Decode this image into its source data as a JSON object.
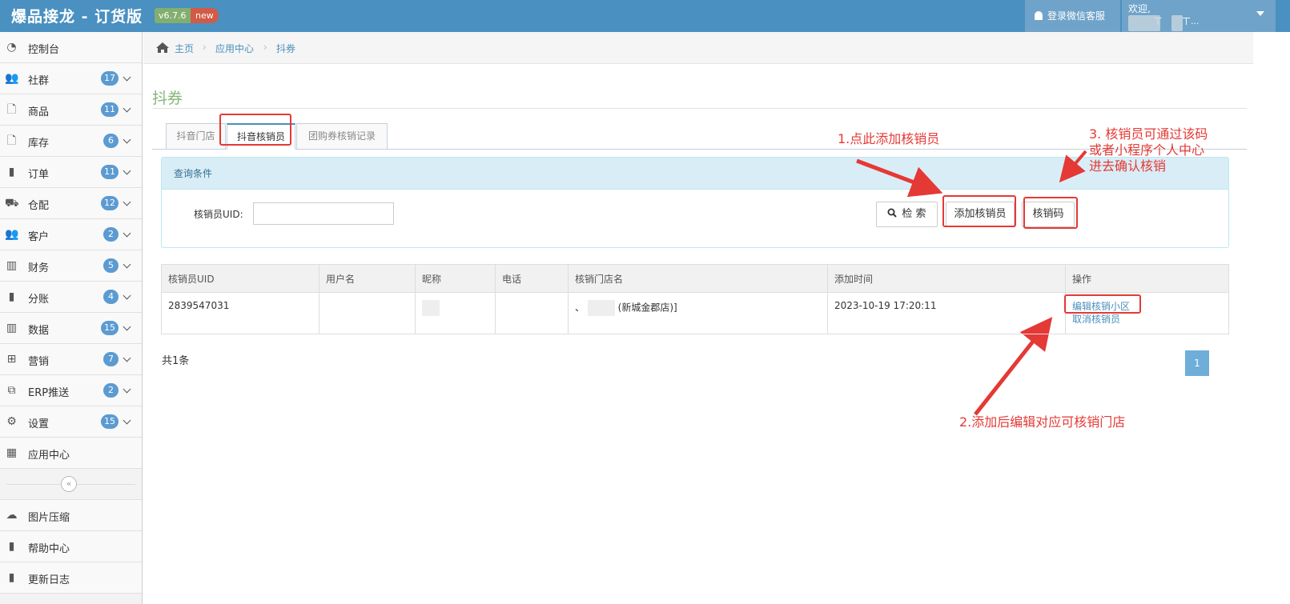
{
  "app": {
    "title": "爆品接龙 - 订货版",
    "version": "v6.7.6",
    "new_badge": "new"
  },
  "topbar": {
    "wechat_service": "登录微信客服",
    "welcome": "欢迎,",
    "user_masked": "         ㄒ       ㄒ..."
  },
  "sidebar": {
    "items": [
      {
        "label": "控制台",
        "icon": "dashboard-icon"
      },
      {
        "label": "社群",
        "count": "17",
        "icon": "users-icon"
      },
      {
        "label": "商品",
        "count": "11",
        "icon": "file-icon"
      },
      {
        "label": "库存",
        "count": "6",
        "icon": "file-icon"
      },
      {
        "label": "订单",
        "count": "11",
        "icon": "book-icon"
      },
      {
        "label": "仓配",
        "count": "12",
        "icon": "truck-icon"
      },
      {
        "label": "客户",
        "count": "2",
        "icon": "users-icon"
      },
      {
        "label": "财务",
        "count": "5",
        "icon": "bar-chart-icon"
      },
      {
        "label": "分账",
        "count": "4",
        "icon": "book-icon"
      },
      {
        "label": "数据",
        "count": "15",
        "icon": "bar-chart-icon"
      },
      {
        "label": "营销",
        "count": "7",
        "icon": "gift-icon"
      },
      {
        "label": "ERP推送",
        "count": "2",
        "icon": "copy-icon"
      },
      {
        "label": "设置",
        "count": "15",
        "icon": "gears-icon"
      },
      {
        "label": "应用中心",
        "icon": "grid-icon"
      }
    ],
    "collapse_symbol": "«",
    "bottom_items": [
      {
        "label": "图片压缩",
        "icon": "cloud-upload-icon"
      },
      {
        "label": "帮助中心",
        "icon": "book-icon"
      },
      {
        "label": "更新日志",
        "icon": "book-icon"
      }
    ]
  },
  "breadcrumb": {
    "home": "主页",
    "app_center": "应用中心",
    "current": "抖券",
    "sep": "›"
  },
  "page": {
    "title": "抖券"
  },
  "tabs": [
    {
      "label": "抖音门店"
    },
    {
      "label": "抖音核销员"
    },
    {
      "label": "团购券核销记录"
    }
  ],
  "query": {
    "heading": "查询条件",
    "uid_label": "核销员UID:",
    "uid_value": "",
    "search_label": "检 索",
    "add_verifier_label": "添加核销员",
    "verify_code_label": "核销码"
  },
  "annotations": {
    "step1": "1.点此添加核销员",
    "step2": "2.添加后编辑对应可核销门店",
    "step3_line1": "3. 核销员可通过该码",
    "step3_line2": "或者小程序个人中心",
    "step3_line3": "进去确认核销"
  },
  "table": {
    "headers": [
      "核销员UID",
      "用户名",
      "昵称",
      "电话",
      "核销门店名",
      "添加时间",
      "操作"
    ],
    "rows": [
      {
        "uid": "2839547031",
        "username": "",
        "nickname": "",
        "phone": "",
        "store_prefix": "、",
        "store_name": "(新城金郡店)]",
        "added_time": "2023-10-19 17:20:11",
        "action_edit": "编辑核销小区",
        "action_cancel": "取消核销员"
      }
    ]
  },
  "footer": {
    "total": "共1条",
    "page": "1"
  },
  "colors": {
    "topbar": "#4a90c0",
    "accent_green": "#86b57a",
    "annotation_red": "#e53935",
    "badge_blue": "#5b9bd1"
  }
}
